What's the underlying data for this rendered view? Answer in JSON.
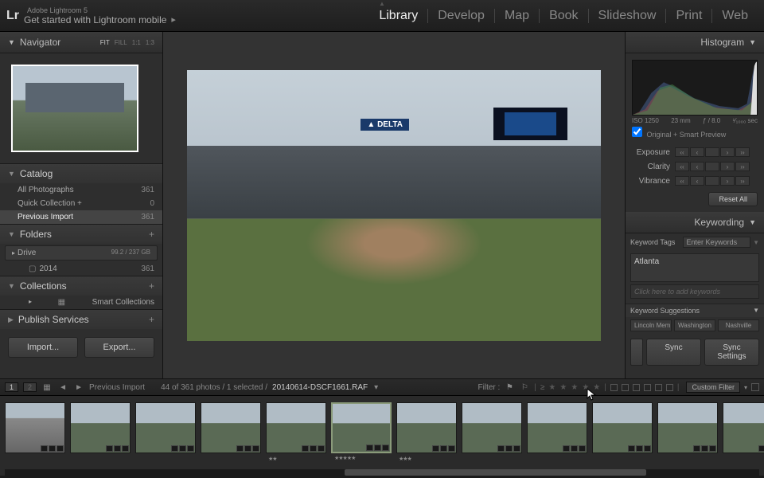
{
  "app": {
    "name": "Lr",
    "version": "Adobe Lightroom 5",
    "tagline": "Get started with Lightroom mobile"
  },
  "nav": {
    "items": [
      "Library",
      "Develop",
      "Map",
      "Book",
      "Slideshow",
      "Print",
      "Web"
    ],
    "active": "Library"
  },
  "navigator": {
    "title": "Navigator",
    "zoom": [
      "FIT",
      "FILL",
      "1:1",
      "1:3"
    ],
    "zoom_active": "FIT"
  },
  "catalog": {
    "title": "Catalog",
    "rows": [
      {
        "label": "All Photographs",
        "count": "361"
      },
      {
        "label": "Quick Collection  +",
        "count": "0"
      },
      {
        "label": "Previous Import",
        "count": "361",
        "selected": true
      }
    ]
  },
  "folders": {
    "title": "Folders",
    "drive": {
      "label": "Drive",
      "stats": "99.2 / 237 GB"
    },
    "sub": {
      "label": "2014",
      "count": "361"
    }
  },
  "collections": {
    "title": "Collections",
    "row": "Smart Collections"
  },
  "publish": {
    "title": "Publish Services"
  },
  "buttons": {
    "import": "Import...",
    "export": "Export..."
  },
  "histogram": {
    "title": "Histogram",
    "info": {
      "iso": "ISO 1250",
      "focal": "23 mm",
      "aperture": "ƒ / 8.0",
      "shutter": "¹⁄₁₀₀₀ sec"
    },
    "preview_label": "Original + Smart Preview"
  },
  "quickdev": {
    "rows": [
      {
        "label": "Exposure"
      },
      {
        "label": "Clarity"
      },
      {
        "label": "Vibrance"
      }
    ],
    "reset": "Reset All"
  },
  "keywording": {
    "title": "Keywording",
    "tags_label": "Keyword Tags",
    "tags_dd": "Enter Keywords",
    "value": "Atlanta",
    "input_placeholder": "Click here to add keywords",
    "sugg_title": "Keyword Suggestions",
    "sugg": [
      "Lincoln Mem...",
      "Washington",
      "Nashville"
    ]
  },
  "sync": {
    "sync": "Sync",
    "settings": "Sync Settings"
  },
  "toolbar": {
    "pages": [
      "1",
      "2"
    ],
    "breadcrumb": "Previous Import",
    "status": "44 of 361 photos / 1 selected /",
    "file": "20140614-DSCF1661.RAF",
    "filter_label": "Filter :",
    "filter_dd": "Custom Filter"
  },
  "main_sign": "▲ DELTA",
  "filmstrip": [
    {
      "type": "car"
    },
    {
      "type": "std"
    },
    {
      "type": "std"
    },
    {
      "type": "std",
      "rb": true
    },
    {
      "type": "std",
      "stars": 2
    },
    {
      "type": "sel",
      "stars": 5
    },
    {
      "type": "sel2",
      "stars": 3
    },
    {
      "type": "std"
    },
    {
      "type": "std"
    },
    {
      "type": "std"
    },
    {
      "type": "std"
    },
    {
      "type": "std"
    }
  ]
}
